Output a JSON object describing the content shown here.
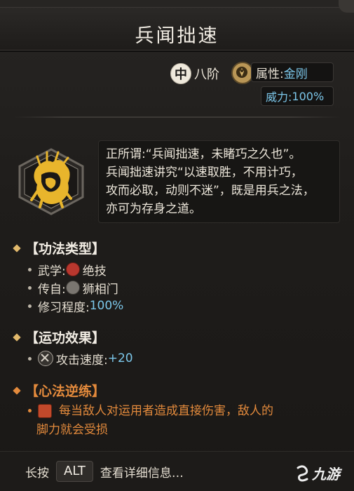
{
  "title": "兵闻拙速",
  "level": {
    "badge": "中",
    "text": "八阶"
  },
  "attribute": {
    "label": "属性: ",
    "value": "金刚"
  },
  "power": {
    "label": "威力: ",
    "value": "100%"
  },
  "description": [
    "正所谓:“兵闻拙速，未睹巧之久也”。",
    "兵闻拙速讲究“以速取胜，不用计巧，",
    "攻而必取，动则不迷”，既是用兵之法，",
    "亦可为存身之道。"
  ],
  "sections": {
    "type": {
      "heading": "【功法类型】",
      "rows": [
        {
          "label": "武学: ",
          "value": "绝技",
          "icon": "red-emblem-icon"
        },
        {
          "label": "传自: ",
          "value": "狮相门",
          "icon": "sect-emblem-icon"
        },
        {
          "label": "修习程度: ",
          "value": "100%"
        }
      ]
    },
    "effect": {
      "heading": "【运功效果】",
      "rows": [
        {
          "label": "攻击速度: ",
          "value": "+20",
          "icon": "crossed-swords-icon"
        }
      ]
    },
    "reverse": {
      "heading": "【心法逆练】",
      "lines": [
        "每当敌人对运用者造成直接伤害，敌人的",
        "脚力就会受损"
      ],
      "icon": "reverse-practice-icon"
    }
  },
  "footer": {
    "prefix": "长按",
    "key": "ALT",
    "suffix": "查看详细信息…"
  },
  "watermark": "九游",
  "colors": {
    "accent_cyan": "#7cc7ea",
    "accent_orange": "#e38a3c",
    "gold": "#e2b96c"
  }
}
